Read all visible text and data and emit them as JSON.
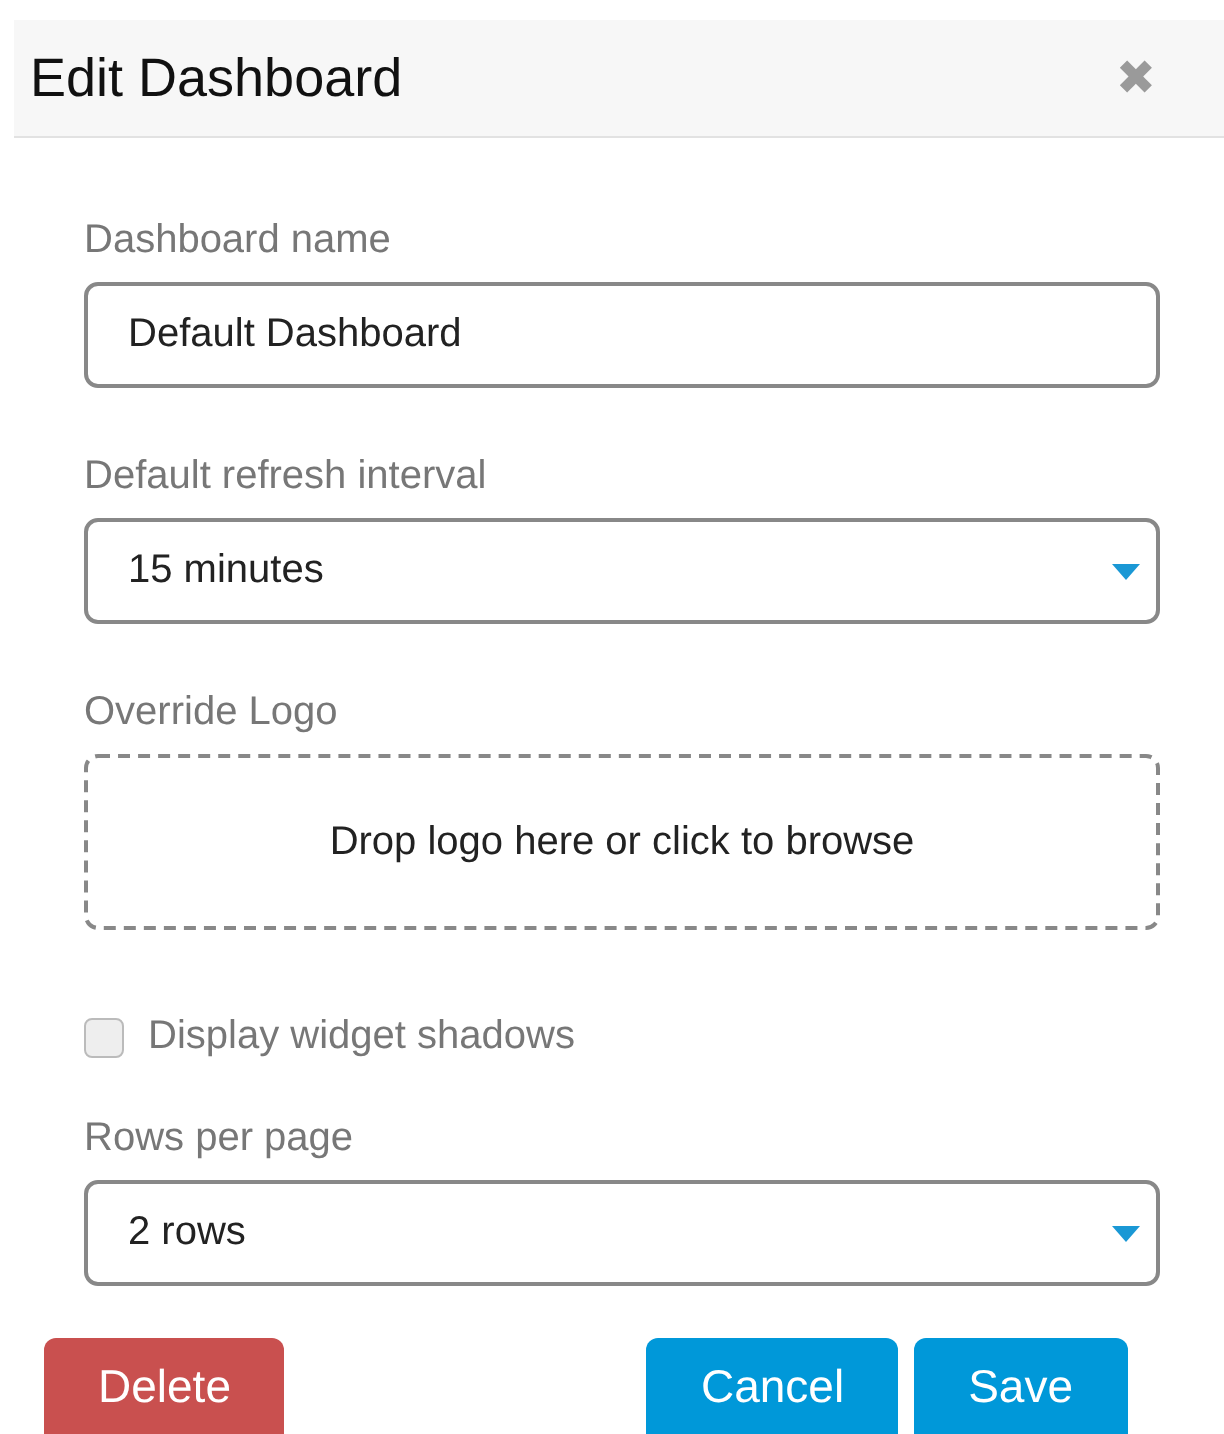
{
  "dialog": {
    "title": "Edit Dashboard",
    "close": "✖"
  },
  "fields": [
    {
      "kind": "text",
      "label": "Dashboard name",
      "value": "Default Dashboard"
    },
    {
      "kind": "select",
      "label": "Default refresh interval",
      "value": "15 minutes"
    },
    {
      "kind": "dropzone",
      "label": "Override Logo",
      "placeholder": "Drop logo here or click to browse"
    },
    {
      "kind": "checkbox",
      "label": "Display widget shadows",
      "checked": false
    },
    {
      "kind": "select",
      "label": "Rows per page",
      "value": "2 rows"
    }
  ],
  "buttons": [
    {
      "label": "Delete",
      "kind": "danger"
    },
    {
      "label": "Cancel",
      "kind": "primary"
    },
    {
      "label": "Save",
      "kind": "primary"
    }
  ]
}
